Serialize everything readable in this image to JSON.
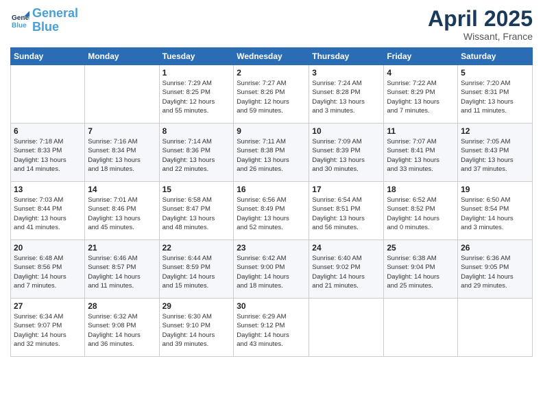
{
  "header": {
    "logo_line1": "General",
    "logo_line2": "Blue",
    "month": "April 2025",
    "location": "Wissant, France"
  },
  "weekdays": [
    "Sunday",
    "Monday",
    "Tuesday",
    "Wednesday",
    "Thursday",
    "Friday",
    "Saturday"
  ],
  "weeks": [
    [
      {
        "day": "",
        "info": ""
      },
      {
        "day": "",
        "info": ""
      },
      {
        "day": "1",
        "info": "Sunrise: 7:29 AM\nSunset: 8:25 PM\nDaylight: 12 hours\nand 55 minutes."
      },
      {
        "day": "2",
        "info": "Sunrise: 7:27 AM\nSunset: 8:26 PM\nDaylight: 12 hours\nand 59 minutes."
      },
      {
        "day": "3",
        "info": "Sunrise: 7:24 AM\nSunset: 8:28 PM\nDaylight: 13 hours\nand 3 minutes."
      },
      {
        "day": "4",
        "info": "Sunrise: 7:22 AM\nSunset: 8:29 PM\nDaylight: 13 hours\nand 7 minutes."
      },
      {
        "day": "5",
        "info": "Sunrise: 7:20 AM\nSunset: 8:31 PM\nDaylight: 13 hours\nand 11 minutes."
      }
    ],
    [
      {
        "day": "6",
        "info": "Sunrise: 7:18 AM\nSunset: 8:33 PM\nDaylight: 13 hours\nand 14 minutes."
      },
      {
        "day": "7",
        "info": "Sunrise: 7:16 AM\nSunset: 8:34 PM\nDaylight: 13 hours\nand 18 minutes."
      },
      {
        "day": "8",
        "info": "Sunrise: 7:14 AM\nSunset: 8:36 PM\nDaylight: 13 hours\nand 22 minutes."
      },
      {
        "day": "9",
        "info": "Sunrise: 7:11 AM\nSunset: 8:38 PM\nDaylight: 13 hours\nand 26 minutes."
      },
      {
        "day": "10",
        "info": "Sunrise: 7:09 AM\nSunset: 8:39 PM\nDaylight: 13 hours\nand 30 minutes."
      },
      {
        "day": "11",
        "info": "Sunrise: 7:07 AM\nSunset: 8:41 PM\nDaylight: 13 hours\nand 33 minutes."
      },
      {
        "day": "12",
        "info": "Sunrise: 7:05 AM\nSunset: 8:43 PM\nDaylight: 13 hours\nand 37 minutes."
      }
    ],
    [
      {
        "day": "13",
        "info": "Sunrise: 7:03 AM\nSunset: 8:44 PM\nDaylight: 13 hours\nand 41 minutes."
      },
      {
        "day": "14",
        "info": "Sunrise: 7:01 AM\nSunset: 8:46 PM\nDaylight: 13 hours\nand 45 minutes."
      },
      {
        "day": "15",
        "info": "Sunrise: 6:58 AM\nSunset: 8:47 PM\nDaylight: 13 hours\nand 48 minutes."
      },
      {
        "day": "16",
        "info": "Sunrise: 6:56 AM\nSunset: 8:49 PM\nDaylight: 13 hours\nand 52 minutes."
      },
      {
        "day": "17",
        "info": "Sunrise: 6:54 AM\nSunset: 8:51 PM\nDaylight: 13 hours\nand 56 minutes."
      },
      {
        "day": "18",
        "info": "Sunrise: 6:52 AM\nSunset: 8:52 PM\nDaylight: 14 hours\nand 0 minutes."
      },
      {
        "day": "19",
        "info": "Sunrise: 6:50 AM\nSunset: 8:54 PM\nDaylight: 14 hours\nand 3 minutes."
      }
    ],
    [
      {
        "day": "20",
        "info": "Sunrise: 6:48 AM\nSunset: 8:56 PM\nDaylight: 14 hours\nand 7 minutes."
      },
      {
        "day": "21",
        "info": "Sunrise: 6:46 AM\nSunset: 8:57 PM\nDaylight: 14 hours\nand 11 minutes."
      },
      {
        "day": "22",
        "info": "Sunrise: 6:44 AM\nSunset: 8:59 PM\nDaylight: 14 hours\nand 15 minutes."
      },
      {
        "day": "23",
        "info": "Sunrise: 6:42 AM\nSunset: 9:00 PM\nDaylight: 14 hours\nand 18 minutes."
      },
      {
        "day": "24",
        "info": "Sunrise: 6:40 AM\nSunset: 9:02 PM\nDaylight: 14 hours\nand 21 minutes."
      },
      {
        "day": "25",
        "info": "Sunrise: 6:38 AM\nSunset: 9:04 PM\nDaylight: 14 hours\nand 25 minutes."
      },
      {
        "day": "26",
        "info": "Sunrise: 6:36 AM\nSunset: 9:05 PM\nDaylight: 14 hours\nand 29 minutes."
      }
    ],
    [
      {
        "day": "27",
        "info": "Sunrise: 6:34 AM\nSunset: 9:07 PM\nDaylight: 14 hours\nand 32 minutes."
      },
      {
        "day": "28",
        "info": "Sunrise: 6:32 AM\nSunset: 9:08 PM\nDaylight: 14 hours\nand 36 minutes."
      },
      {
        "day": "29",
        "info": "Sunrise: 6:30 AM\nSunset: 9:10 PM\nDaylight: 14 hours\nand 39 minutes."
      },
      {
        "day": "30",
        "info": "Sunrise: 6:29 AM\nSunset: 9:12 PM\nDaylight: 14 hours\nand 43 minutes."
      },
      {
        "day": "",
        "info": ""
      },
      {
        "day": "",
        "info": ""
      },
      {
        "day": "",
        "info": ""
      }
    ]
  ]
}
